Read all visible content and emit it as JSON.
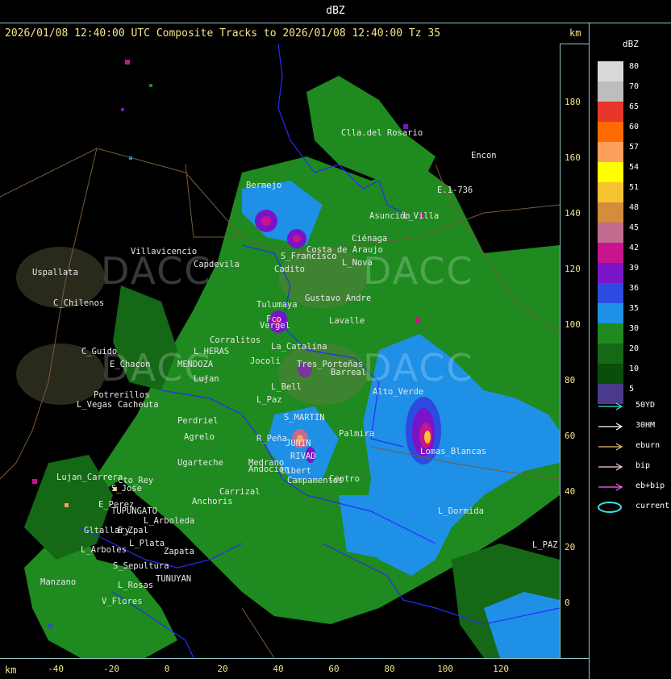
{
  "window": {
    "title": "dBZ"
  },
  "header": {
    "text": "2026/01/08 12:40:00 UTC Composite Tracks to 2026/01/08 12:40:00 Tz 35",
    "units": "km"
  },
  "axes": {
    "unit": "km",
    "x_ticks": [
      "-40",
      "-20",
      "0",
      "20",
      "40",
      "60",
      "80",
      "100",
      "120"
    ],
    "y_ticks": [
      "180",
      "160",
      "140",
      "120",
      "100",
      "80",
      "60",
      "40",
      "20",
      "0"
    ]
  },
  "legend": {
    "title": "dBZ",
    "scale": [
      {
        "label": "80",
        "color": "#d9d9d9"
      },
      {
        "label": "70",
        "color": "#bdbdbd"
      },
      {
        "label": "65",
        "color": "#e8352a"
      },
      {
        "label": "60",
        "color": "#ff6a00"
      },
      {
        "label": "57",
        "color": "#ff9f5c"
      },
      {
        "label": "54",
        "color": "#ffff00"
      },
      {
        "label": "51",
        "color": "#f5c232"
      },
      {
        "label": "48",
        "color": "#d48c3d"
      },
      {
        "label": "45",
        "color": "#c26b8f"
      },
      {
        "label": "42",
        "color": "#c8148f"
      },
      {
        "label": "39",
        "color": "#7a14c8"
      },
      {
        "label": "36",
        "color": "#2d4be0"
      },
      {
        "label": "35",
        "color": "#1e90e6"
      },
      {
        "label": "30",
        "color": "#1f8a1f"
      },
      {
        "label": "20",
        "color": "#156815"
      },
      {
        "label": "10",
        "color": "#0b4d0b"
      },
      {
        "label": "5",
        "color": "#4a3a8a"
      }
    ],
    "tracks": [
      {
        "label": "50YD",
        "color": "#40e0e0"
      },
      {
        "label": "30HM",
        "color": "#ffffff"
      },
      {
        "label": "eburn",
        "color": "#f0c070"
      },
      {
        "label": "bip",
        "color": "#ffd0d0"
      },
      {
        "label": "eb+bip",
        "color": "#ff60ff"
      },
      {
        "label": "current",
        "color": "#40e0e0"
      }
    ]
  },
  "watermark": {
    "text": "DACC"
  },
  "cities": [
    {
      "name": "Clla.del Rosario"
    },
    {
      "name": "Encon"
    },
    {
      "name": "E.1-736"
    },
    {
      "name": "Villavicencio"
    },
    {
      "name": "Capdevila"
    },
    {
      "name": "Uspallata"
    },
    {
      "name": "C_Chilenos"
    },
    {
      "name": "C_Guido"
    },
    {
      "name": "E_Chacon"
    },
    {
      "name": "L_HERAS"
    },
    {
      "name": "MENDOZA"
    },
    {
      "name": "Lujan"
    },
    {
      "name": "Potrerillos"
    },
    {
      "name": "L_Vegas"
    },
    {
      "name": "Cacheuta"
    },
    {
      "name": "Perdriel"
    },
    {
      "name": "Agrelo"
    },
    {
      "name": "Ugarteche"
    },
    {
      "name": "Carrizal"
    },
    {
      "name": "Anchoris"
    },
    {
      "name": "E_Perez"
    },
    {
      "name": "TUPUNGATO"
    },
    {
      "name": "L_Arboleda"
    },
    {
      "name": "Gltallary"
    },
    {
      "name": "E_Zpal"
    },
    {
      "name": "L_Plata"
    },
    {
      "name": "L_Arboles"
    },
    {
      "name": "Zapata"
    },
    {
      "name": "S_Sepultura"
    },
    {
      "name": "TUNUYAN"
    },
    {
      "name": "L_Rosas"
    },
    {
      "name": "V_Flores"
    },
    {
      "name": "Manzano"
    },
    {
      "name": "Cto_Rey"
    },
    {
      "name": "S_Jose"
    },
    {
      "name": "Lujan_Carrera"
    },
    {
      "name": "Tulumaya"
    },
    {
      "name": "Vergel"
    },
    {
      "name": "Fco"
    },
    {
      "name": "Corralitos"
    },
    {
      "name": "Tres_Porteñas"
    },
    {
      "name": "L_Bell"
    },
    {
      "name": "L_Paz"
    },
    {
      "name": "S_MARTIN"
    },
    {
      "name": "Palmira"
    },
    {
      "name": "R_Peña"
    },
    {
      "name": "JUNIN"
    },
    {
      "name": "RIVAD"
    },
    {
      "name": "Medrano"
    },
    {
      "name": "Andocion"
    },
    {
      "name": "Libert"
    },
    {
      "name": "Campamentos"
    },
    {
      "name": "Centro"
    },
    {
      "name": "Lomas_Blancas"
    },
    {
      "name": "L_Dormida"
    },
    {
      "name": "L_PAZ"
    },
    {
      "name": "Bermejo"
    },
    {
      "name": "Costa de Araujo"
    },
    {
      "name": "Gustavo Andre"
    },
    {
      "name": "Lavalle"
    },
    {
      "name": "Jocoli"
    },
    {
      "name": "S_Francisco"
    },
    {
      "name": "L_Nova"
    },
    {
      "name": "Ciénaga"
    },
    {
      "name": "Asunción"
    },
    {
      "name": "L_Villa"
    },
    {
      "name": "Cadito"
    },
    {
      "name": "Barreal"
    },
    {
      "name": "La_Catalina"
    },
    {
      "name": "Alto_Verde"
    },
    {
      "name": "Carmelita"
    }
  ]
}
